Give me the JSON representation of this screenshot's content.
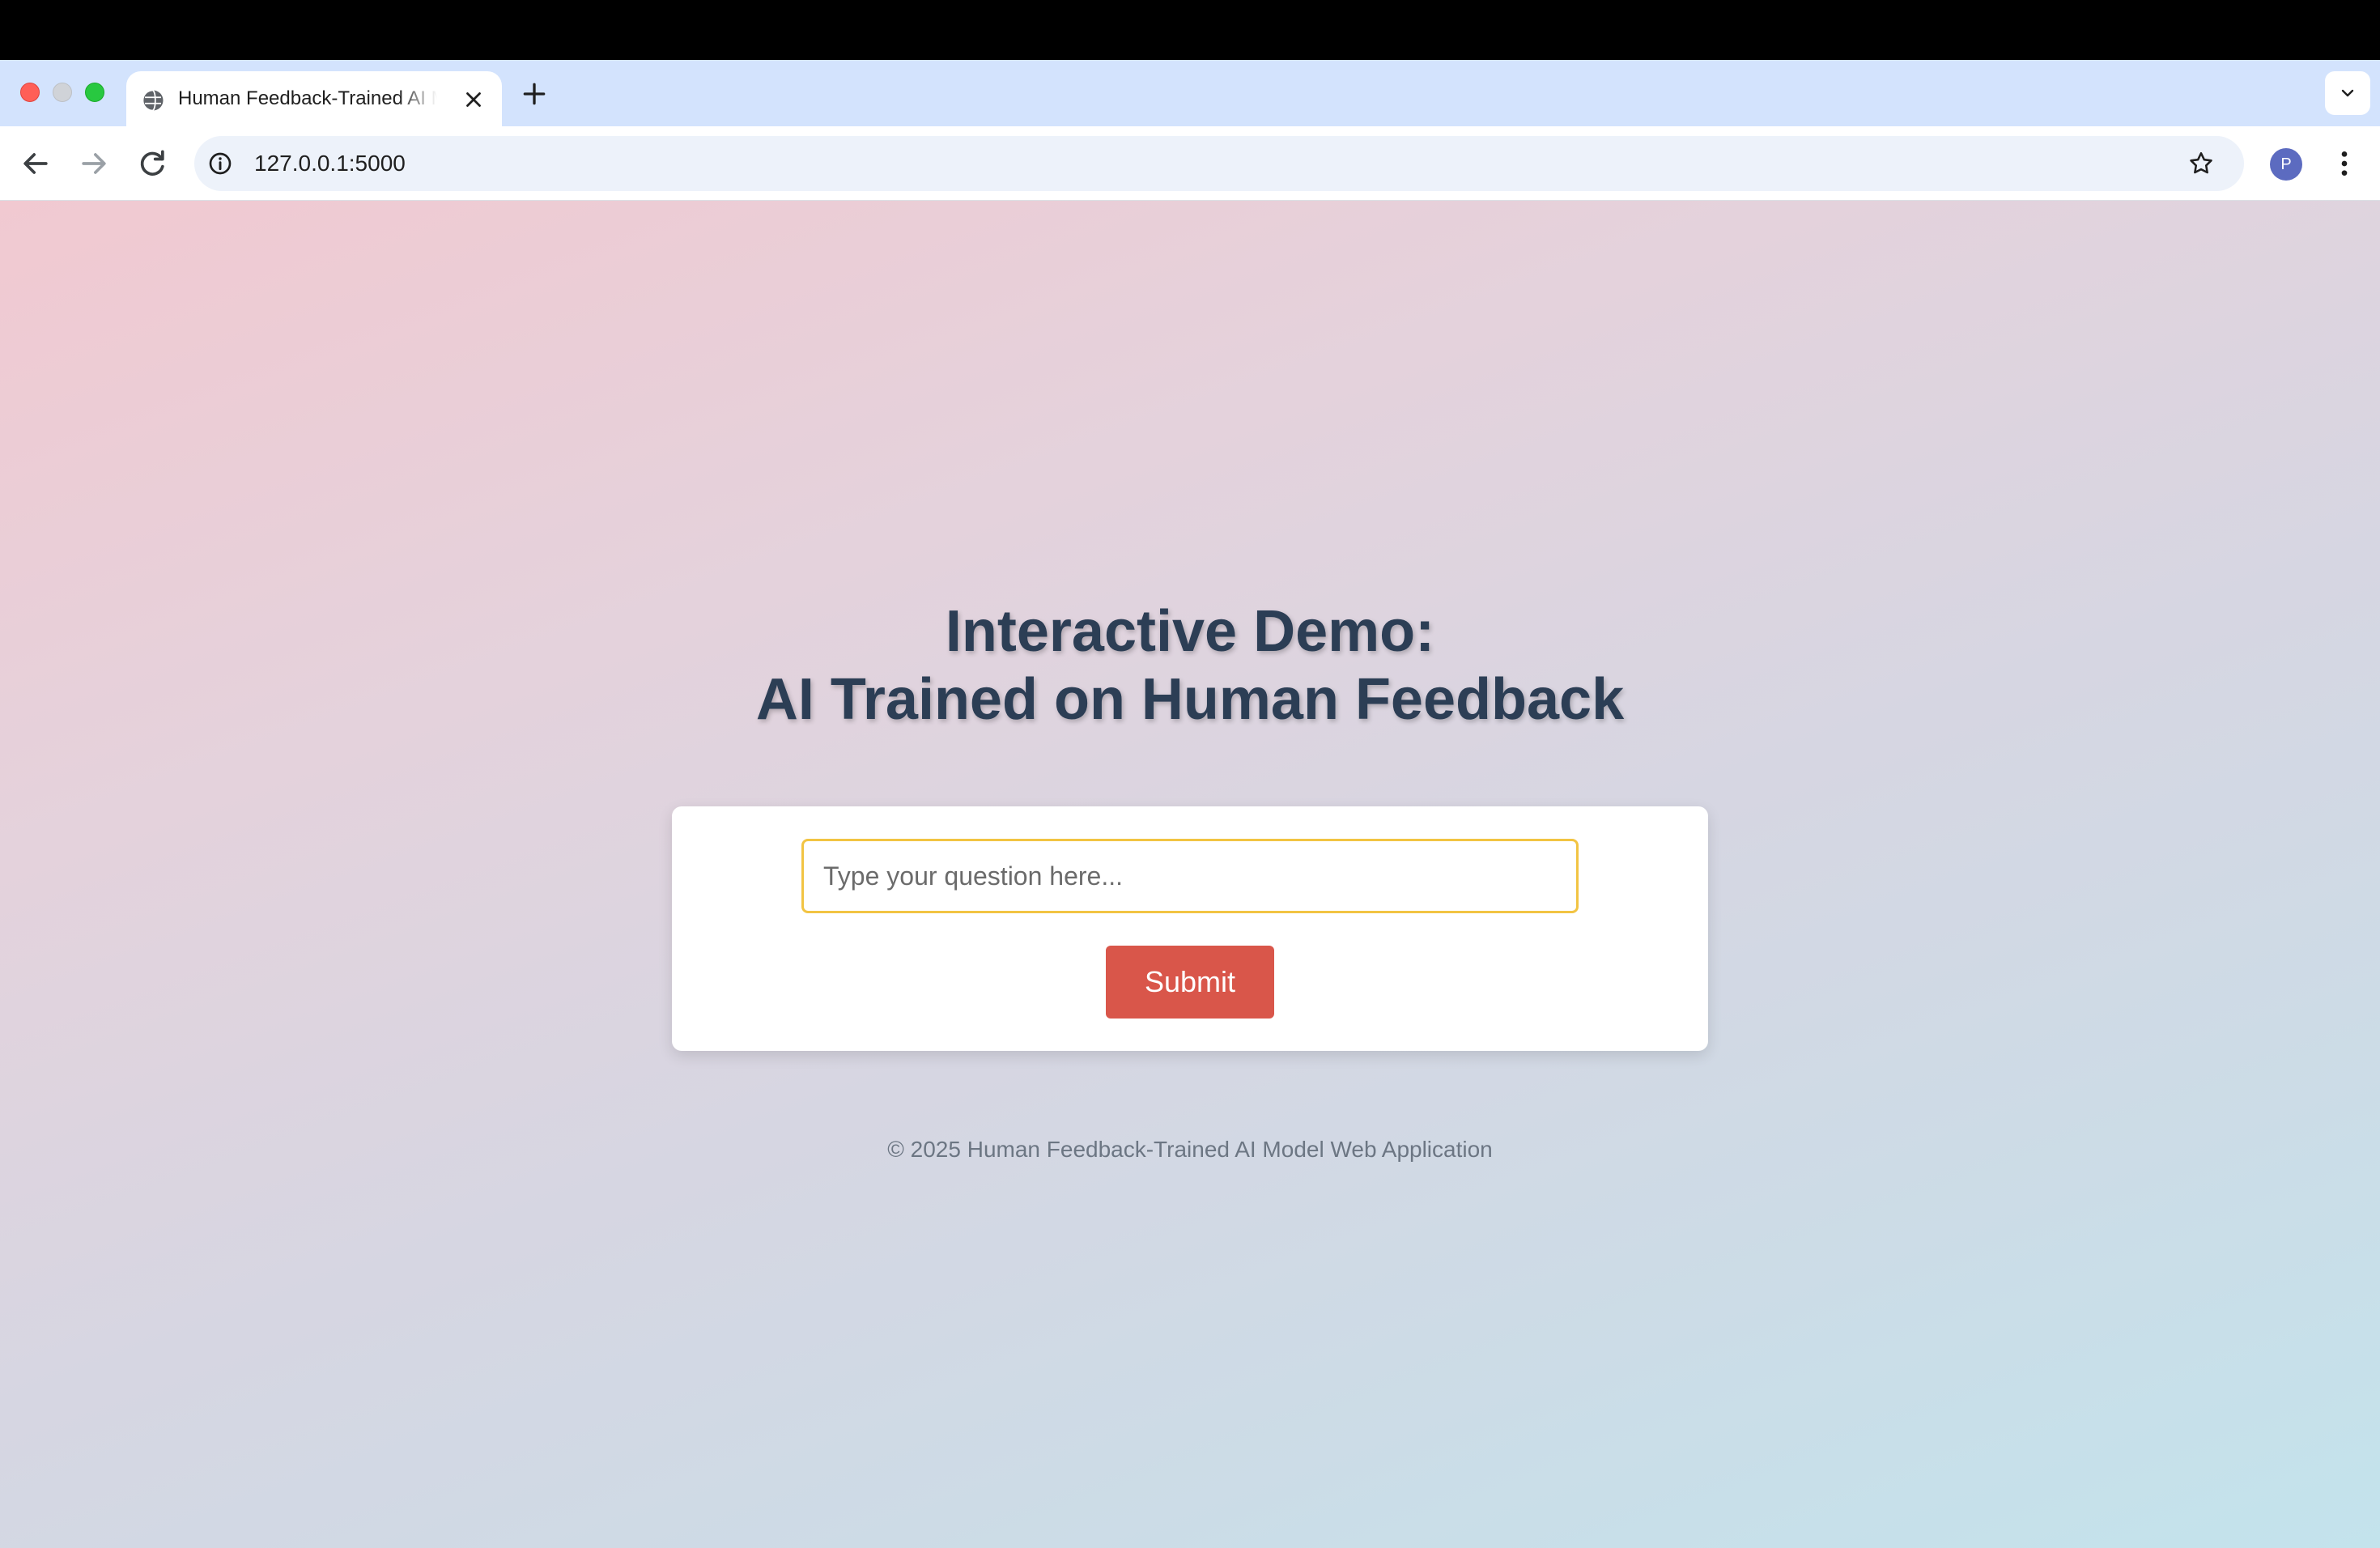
{
  "browser": {
    "tab_title": "Human Feedback-Trained AI Model Web Application",
    "url": "127.0.0.1:5000",
    "profile_initial": "P"
  },
  "page": {
    "heading_line1": "Interactive Demo:",
    "heading_line2": "AI Trained on Human Feedback",
    "question_placeholder": "Type your question here...",
    "question_value": "",
    "submit_label": "Submit",
    "footer": "© 2025 Human Feedback-Trained AI Model Web Application"
  },
  "colors": {
    "accent_input_border": "#f2c443",
    "submit_bg": "#d9564a",
    "heading": "#2c3e55"
  },
  "icons": [
    "globe-icon",
    "close-icon",
    "plus-icon",
    "chevron-down-icon",
    "back-arrow-icon",
    "forward-arrow-icon",
    "reload-icon",
    "info-icon",
    "star-icon",
    "more-vert-icon"
  ]
}
